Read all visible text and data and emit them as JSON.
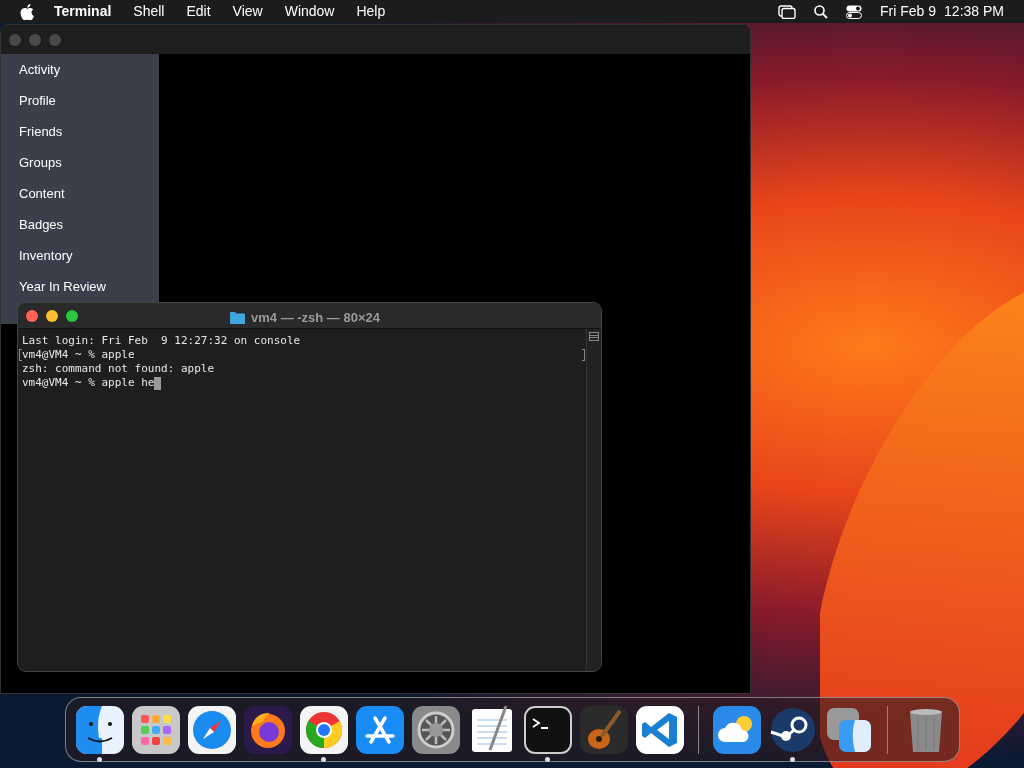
{
  "menu_bar": {
    "app_name": "Terminal",
    "menus": [
      "Shell",
      "Edit",
      "View",
      "Window",
      "Help"
    ],
    "date": "Fri Feb 9",
    "time": "12:38 PM"
  },
  "back_window": {
    "sidebar": {
      "items": [
        "Activity",
        "Profile",
        "Friends",
        "Groups",
        "Content",
        "Badges",
        "Inventory",
        "Year In Review"
      ]
    }
  },
  "terminal": {
    "title": "vm4 — -zsh — 80×24",
    "lines": [
      {
        "text": "Last login: Fri Feb  9 12:27:32 on console",
        "marked": false,
        "cursor": false
      },
      {
        "text": "vm4@VM4 ~ % apple",
        "marked": true,
        "cursor": false
      },
      {
        "text": "zsh: command not found: apple",
        "marked": false,
        "cursor": false
      },
      {
        "text": "vm4@VM4 ~ % apple he",
        "marked": false,
        "cursor": true
      }
    ]
  },
  "dock": {
    "items": [
      {
        "kind": "finder",
        "running": true
      },
      {
        "kind": "launchpad",
        "running": false
      },
      {
        "kind": "safari",
        "running": false
      },
      {
        "kind": "firefox",
        "running": false
      },
      {
        "kind": "chrome",
        "running": true
      },
      {
        "kind": "appstore",
        "running": false
      },
      {
        "kind": "settings",
        "running": false
      },
      {
        "kind": "textedit",
        "running": false
      },
      {
        "kind": "terminal",
        "running": true
      },
      {
        "kind": "garageband",
        "running": false
      },
      {
        "kind": "vscode",
        "running": false
      },
      {
        "kind": "separator"
      },
      {
        "kind": "weather",
        "running": false
      },
      {
        "kind": "steam",
        "running": true
      },
      {
        "kind": "migration",
        "running": false
      },
      {
        "kind": "separator"
      },
      {
        "kind": "trash",
        "running": false
      }
    ]
  }
}
